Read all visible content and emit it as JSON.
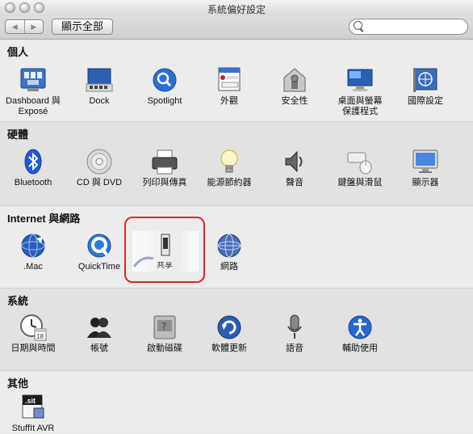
{
  "window": {
    "title": "系統偏好設定"
  },
  "toolbar": {
    "back_glyph": "◀",
    "forward_glyph": "▶",
    "show_all_label": "顯示全部",
    "search": {
      "value": "",
      "placeholder": ""
    }
  },
  "sections": {
    "personal": {
      "title": "個人",
      "items": [
        {
          "label": "Dashboard 與 Exposé",
          "icon": "dashboard-expose-icon"
        },
        {
          "label": "Dock",
          "icon": "dock-icon"
        },
        {
          "label": "Spotlight",
          "icon": "spotlight-icon"
        },
        {
          "label": "外觀",
          "icon": "appearance-icon"
        },
        {
          "label": "安全性",
          "icon": "security-icon"
        },
        {
          "label": "桌面與螢幕保護程式",
          "icon": "desktop-screensaver-icon"
        },
        {
          "label": "國際設定",
          "icon": "international-icon"
        }
      ]
    },
    "hardware": {
      "title": "硬體",
      "items": [
        {
          "label": "Bluetooth",
          "icon": "bluetooth-icon"
        },
        {
          "label": "CD 與 DVD",
          "icon": "cd-dvd-icon"
        },
        {
          "label": "列印與傳真",
          "icon": "print-fax-icon"
        },
        {
          "label": "能源節約器",
          "icon": "energy-saver-icon"
        },
        {
          "label": "聲音",
          "icon": "sound-icon"
        },
        {
          "label": "鍵盤與滑鼠",
          "icon": "keyboard-mouse-icon"
        },
        {
          "label": "顯示器",
          "icon": "displays-icon"
        }
      ]
    },
    "internet": {
      "title": "Internet 與網路",
      "items": [
        {
          "label": ".Mac",
          "icon": "dotmac-icon"
        },
        {
          "label": "QuickTime",
          "icon": "quicktime-icon"
        },
        {
          "label": "網路",
          "icon": "network-icon"
        }
      ],
      "dragging_label": "共享"
    },
    "system": {
      "title": "系統",
      "items": [
        {
          "label": "日期與時間",
          "icon": "date-time-icon",
          "badge": "18"
        },
        {
          "label": "帳號",
          "icon": "accounts-icon"
        },
        {
          "label": "啟動磁碟",
          "icon": "startup-disk-icon"
        },
        {
          "label": "軟體更新",
          "icon": "software-update-icon"
        },
        {
          "label": "語音",
          "icon": "speech-icon"
        },
        {
          "label": "輔助使用",
          "icon": "universal-access-icon"
        }
      ]
    },
    "other": {
      "title": "其他",
      "items": [
        {
          "label": "StuffIt AVR",
          "icon": "stuffit-icon",
          "badge": ".sit"
        }
      ]
    }
  },
  "colors": {
    "highlight_ring": "#e32424",
    "spotlight_blue": "#2a6fd6",
    "bluetooth_blue": "#1f5bd8"
  }
}
